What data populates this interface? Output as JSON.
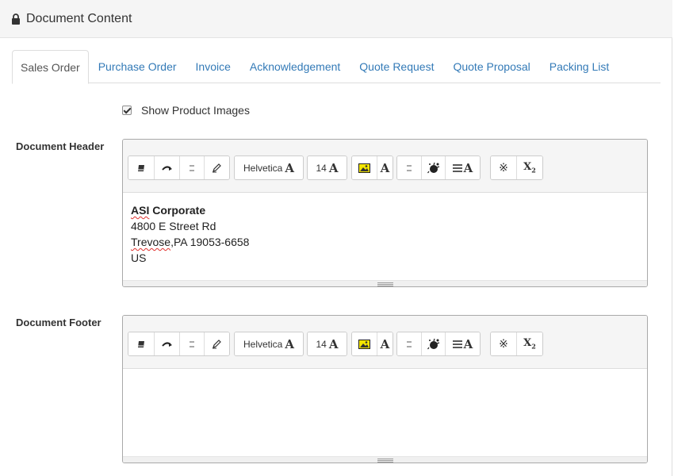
{
  "panel": {
    "title": "Document Content",
    "icon": "lock-icon"
  },
  "tabs": [
    {
      "label": "Sales Order",
      "active": true
    },
    {
      "label": "Purchase Order",
      "active": false
    },
    {
      "label": "Invoice",
      "active": false
    },
    {
      "label": "Acknowledgement",
      "active": false
    },
    {
      "label": "Quote Request",
      "active": false
    },
    {
      "label": "Quote Proposal",
      "active": false
    },
    {
      "label": "Packing List",
      "active": false
    }
  ],
  "show_images": {
    "label": "Show Product Images",
    "checked": true
  },
  "toolbar": {
    "font_name": "Helvetica",
    "font_size": "14",
    "font_glyph": "A",
    "subscript_glyph": "X",
    "subscript_sub": "2"
  },
  "header_editor": {
    "label": "Document Header",
    "lines": {
      "company_prefix": "ASI",
      "company_suffix": " Corporate",
      "street": "4800 E Street Rd",
      "city_prefix": "Trevose",
      "city_suffix": ",PA 19053-6658",
      "country": "US"
    }
  },
  "footer_editor": {
    "label": "Document Footer"
  },
  "colors": {
    "link": "#337ab7",
    "highlight_yellow": "#f4e600"
  }
}
